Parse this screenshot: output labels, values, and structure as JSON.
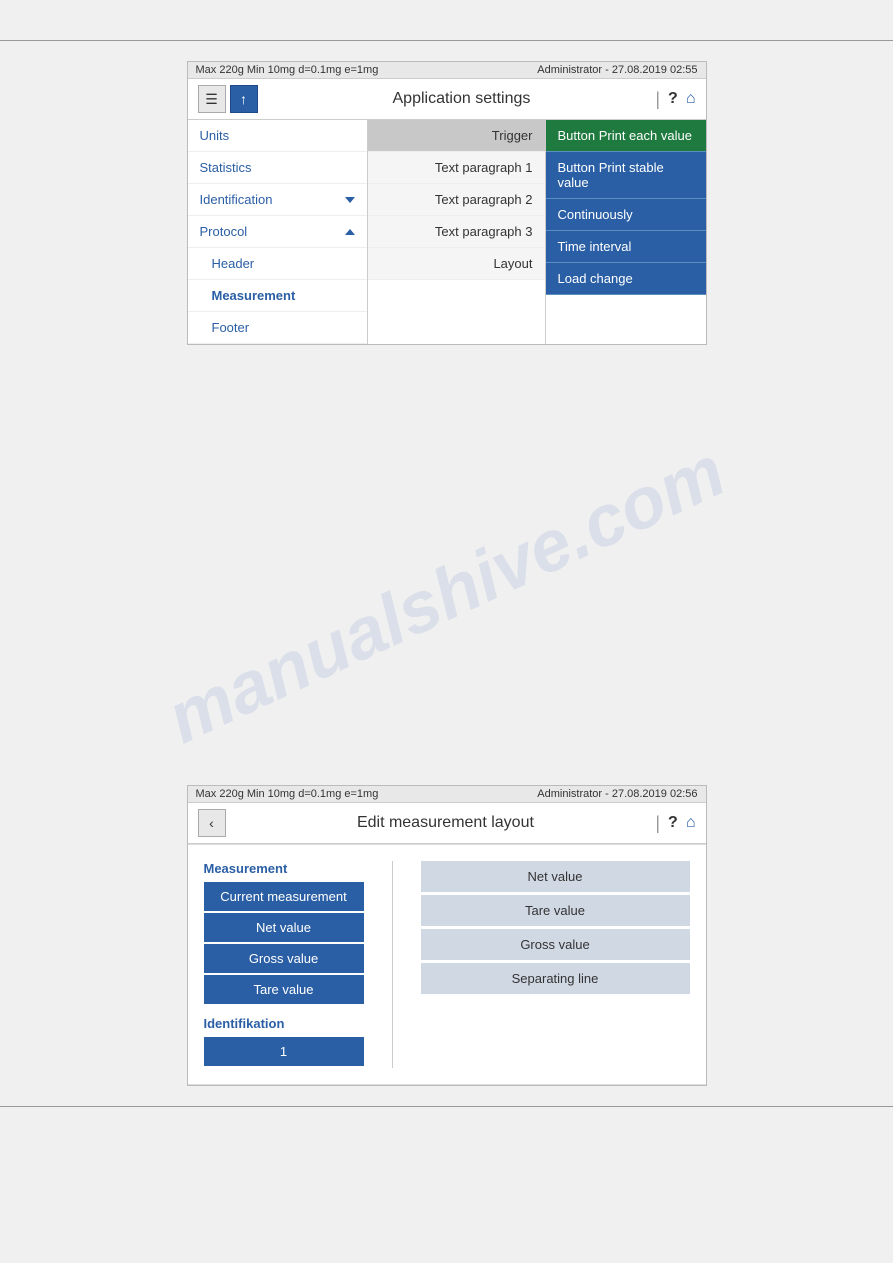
{
  "screen1": {
    "status_bar": {
      "left": "Max 220g  Min 10mg  d=0.1mg  e=1mg",
      "right": "Administrator  -  27.08.2019 02:55"
    },
    "title": "Application settings",
    "nav_items": [
      {
        "label": "Units",
        "has_chevron": false,
        "chevron_type": null,
        "is_sub": false,
        "active": false
      },
      {
        "label": "Statistics",
        "has_chevron": false,
        "chevron_type": null,
        "is_sub": false,
        "active": false
      },
      {
        "label": "Identification",
        "has_chevron": true,
        "chevron_type": "down",
        "is_sub": false,
        "active": false
      },
      {
        "label": "Protocol",
        "has_chevron": true,
        "chevron_type": "up",
        "is_sub": false,
        "active": false
      },
      {
        "label": "Header",
        "has_chevron": false,
        "chevron_type": null,
        "is_sub": true,
        "active": false
      },
      {
        "label": "Measurement",
        "has_chevron": false,
        "chevron_type": null,
        "is_sub": true,
        "active": true
      },
      {
        "label": "Footer",
        "has_chevron": false,
        "chevron_type": null,
        "is_sub": true,
        "active": false
      }
    ],
    "middle_items": [
      {
        "label": "Trigger",
        "active": true
      },
      {
        "label": "Text paragraph 1",
        "active": false
      },
      {
        "label": "Text paragraph 2",
        "active": false
      },
      {
        "label": "Text paragraph 3",
        "active": false
      },
      {
        "label": "Layout",
        "active": false
      }
    ],
    "dropdown_items": [
      {
        "label": "Button Print each value",
        "selected": true
      },
      {
        "label": "Button Print stable value",
        "selected": false
      },
      {
        "label": "Continuously",
        "selected": false
      },
      {
        "label": "Time interval",
        "selected": false
      },
      {
        "label": "Load change",
        "selected": false
      }
    ]
  },
  "screen2": {
    "status_bar": {
      "left": "Max 220g  Min 10mg  d=0.1mg  e=1mg",
      "right": "Administrator  -  27.08.2019 02:56"
    },
    "title": "Edit measurement layout",
    "measurement_section": {
      "title": "Measurement",
      "items": [
        "Current measurement",
        "Net value",
        "Gross value",
        "Tare value"
      ]
    },
    "identifikation_section": {
      "title": "Identifikation",
      "items": [
        "1"
      ]
    },
    "right_items": [
      "Net value",
      "Tare value",
      "Gross value",
      "Separating line"
    ]
  },
  "watermark": "manualshive.com"
}
